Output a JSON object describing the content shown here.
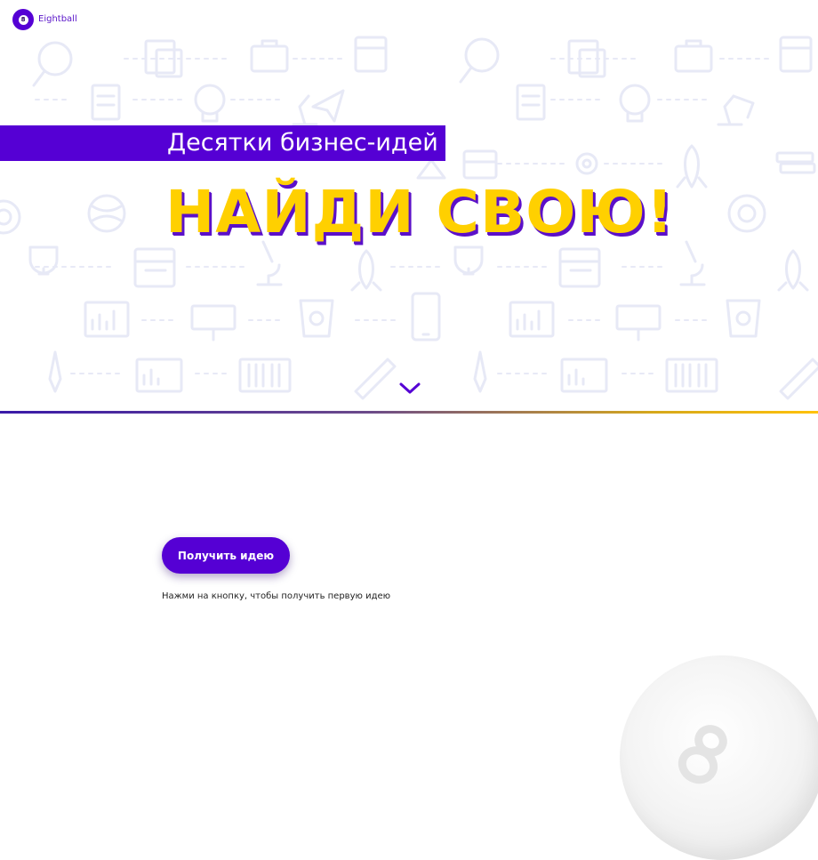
{
  "brand": {
    "name": "Eightball",
    "logo_glyph": "8",
    "color": "#5500d4"
  },
  "hero": {
    "tagline": "Десятки бизнес-идей",
    "headline": "НАЙДИ СВОЮ!",
    "headline_color": "#ffd000",
    "accent_color": "#5500d4",
    "pattern_icons": [
      "magnifier-icon",
      "briefcase-icon",
      "calendar-icon",
      "lightbulb-icon",
      "rocket-icon",
      "globe-icon",
      "trophy-icon",
      "microscope-icon",
      "chart-icon",
      "pen-icon",
      "coffee-icon",
      "phone-icon",
      "gear-icon",
      "books-icon",
      "target-icon"
    ],
    "scroll_icon": "chevron-down-icon"
  },
  "main": {
    "cta_label": "Получить идею",
    "hint": "Нажми на кнопку, чтобы получить первую идею"
  },
  "decor": {
    "ball_icon": "eight-ball-icon"
  }
}
